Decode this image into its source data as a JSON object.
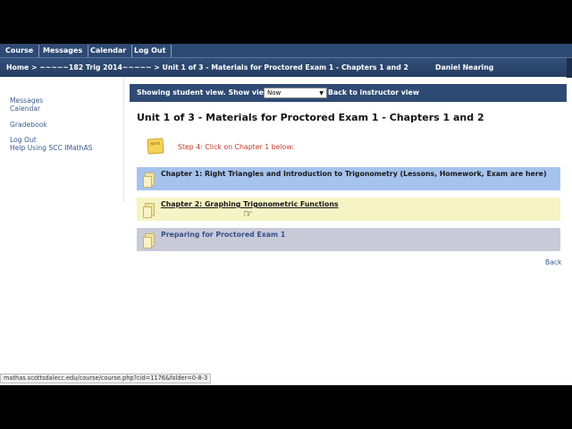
{
  "topnav": {
    "items": [
      "Course",
      "Messages",
      "Calendar",
      "Log Out"
    ]
  },
  "breadcrumb": {
    "text": "Home > ~~~~~182 Trig 2014~~~~~ > Unit 1 of 3 - Materials for Proctored Exam 1 - Chapters 1 and 2",
    "user": "Daniel Nearing"
  },
  "sidebar": {
    "items": [
      "Messages",
      "Calendar",
      "Gradebook",
      "Log Out",
      "Help Using SCC IMathAS"
    ]
  },
  "viewbar": {
    "label": "Showing student view. Show view:",
    "select_value": "Now",
    "back_link": "Back to instructor view"
  },
  "page": {
    "title": "Unit 1 of 3 - Materials for Proctored Exam 1 - Chapters 1 and 2",
    "note_icon_text": "NOTE",
    "step_text": "Step 4: Click on Chapter 1 below:",
    "back": "Back"
  },
  "folders": [
    {
      "title": "Chapter 1: Right Triangles and Introduction to Trigonometry (Lessons, Homework, Exam are here)",
      "color": "#a6c3ee"
    },
    {
      "title": "Chapter 2: Graphing Trigonometric Functions",
      "color": "#f6f3c4"
    },
    {
      "title": "Preparing for Proctored Exam 1",
      "color": "#c8cad8"
    }
  ],
  "statusbar": {
    "url": "mathas.scottsdalecc.edu/course/course.php?cid=1176&folder=0-8-3"
  },
  "colors": {
    "nav_bg": "#2e4a73",
    "link": "#3a5a8c",
    "step_text": "#c0392b"
  }
}
